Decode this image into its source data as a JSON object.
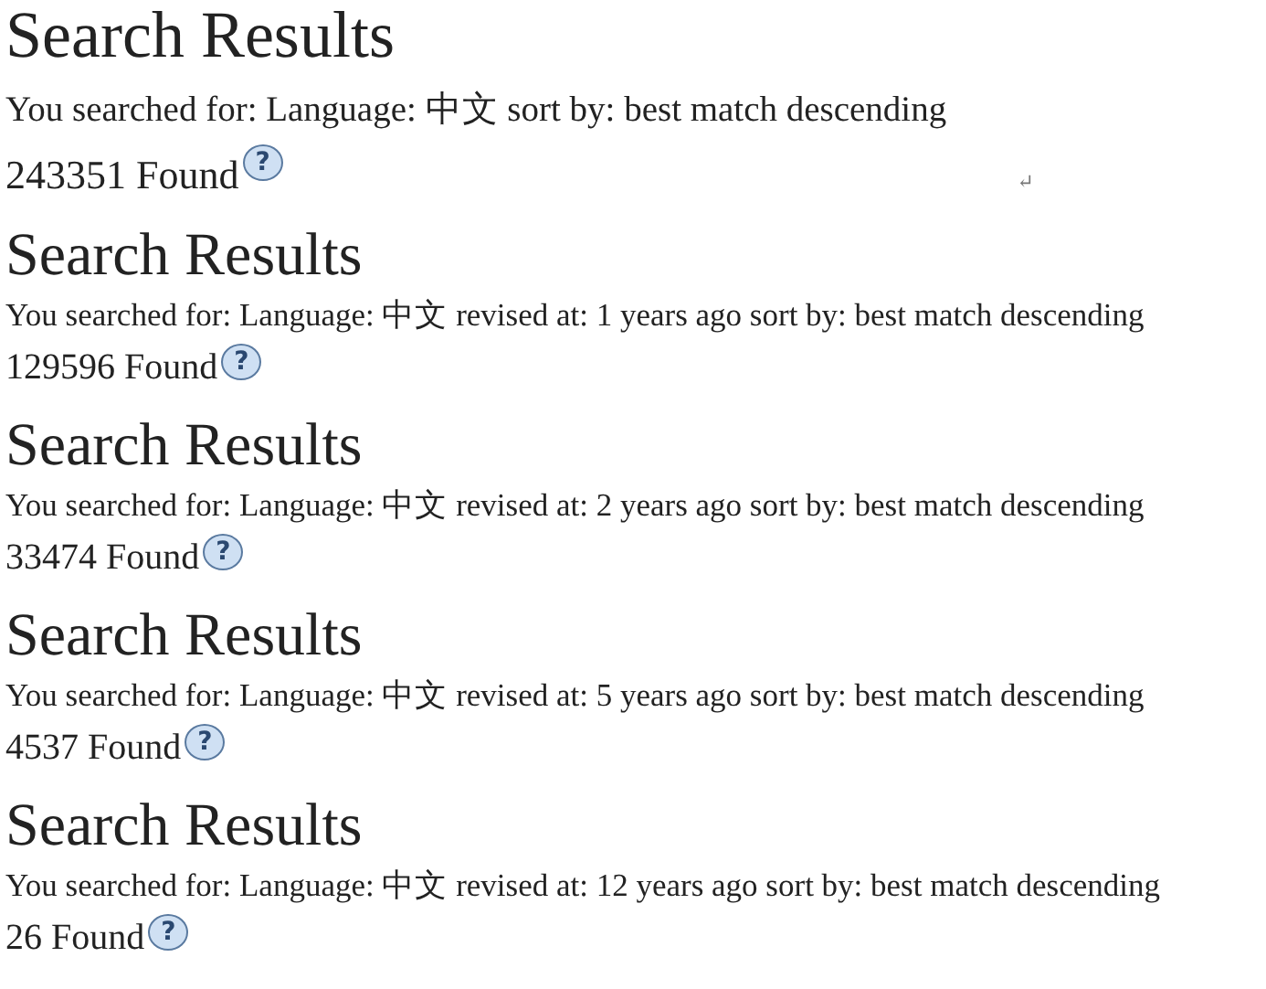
{
  "results": [
    {
      "kind": "large",
      "title": "Search Results",
      "query": "You searched for: Language: 中文 sort by: best match descending",
      "count": "243351 Found",
      "help": "?",
      "return_mark": "↵"
    },
    {
      "kind": "small",
      "title": "Search Results",
      "query": "You searched for: Language: 中文 revised at: 1 years ago sort by: best match descending",
      "count": "129596 Found",
      "help": "?"
    },
    {
      "kind": "small",
      "title": "Search Results",
      "query": "You searched for: Language: 中文 revised at: 2 years ago sort by: best match descending",
      "count": "33474 Found",
      "help": "?"
    },
    {
      "kind": "small",
      "title": "Search Results",
      "query": "You searched for: Language: 中文 revised at: 5 years ago sort by: best match descending",
      "count": "4537 Found",
      "help": "?"
    },
    {
      "kind": "small",
      "title": "Search Results",
      "query": "You searched for: Language: 中文 revised at: 12 years ago sort by: best match descending",
      "count": "26 Found",
      "help": "?"
    }
  ]
}
